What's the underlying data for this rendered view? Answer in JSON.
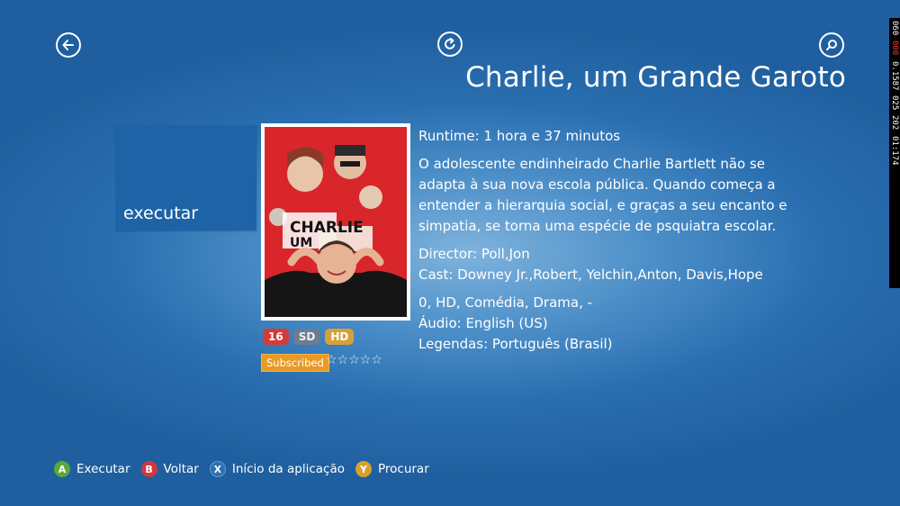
{
  "nav": {
    "back_icon": "back-arrow-icon",
    "refresh_icon": "refresh-icon",
    "search_icon": "search-icon"
  },
  "title": "Charlie, um Grande Garoto",
  "play_tile": {
    "label": "executar"
  },
  "badges": {
    "rating": "16",
    "sd": "SD",
    "hd": "HD"
  },
  "subscribed": "Subscribed",
  "stars": {
    "filled": 0,
    "total": 5,
    "glyph": "☆"
  },
  "details": {
    "runtime": "Runtime: 1 hora e 37 minutos",
    "synopsis": "O adolescente endinheirado Charlie Bartlett não se adapta à sua nova escola pública. Quando começa a entender a hierarquia social, e graças a seu encanto e simpatia, se torna uma espécie de psquiatra escolar.",
    "director": "Director: Poll,Jon",
    "cast": "Cast: Downey Jr.,Robert, Yelchin,Anton, Davis,Hope",
    "genres": "0, HD, Comédia, Drama, -",
    "audio": "Áudio: English (US)",
    "subtitles": "Legendas: Português (Brasil)"
  },
  "hints": [
    {
      "key": "A",
      "label": "Executar",
      "color": "#5aa83a"
    },
    {
      "key": "B",
      "label": "Voltar",
      "color": "#cf3a3a"
    },
    {
      "key": "X",
      "label": "Início da aplicação",
      "color": "#2f6fb4"
    },
    {
      "key": "Y",
      "label": "Procurar",
      "color": "#d7a12c"
    }
  ],
  "debug": [
    "060",
    "000",
    "0.1587",
    "025",
    "202",
    "01:174"
  ],
  "colors": {
    "background": "#2a6fb0",
    "tile": "#1d63a6",
    "subscribed": "#e79b26"
  }
}
